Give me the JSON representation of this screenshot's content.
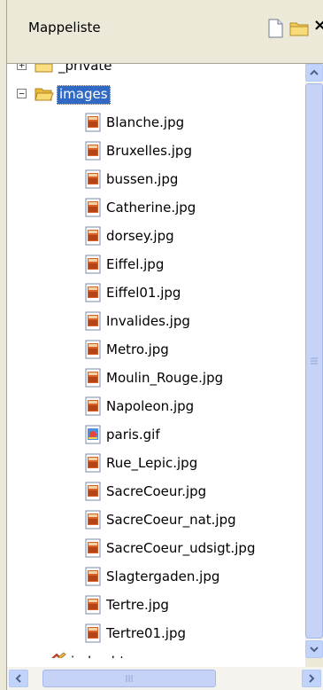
{
  "panel": {
    "title": "Mappeliste",
    "close_glyph": "×"
  },
  "tree": [
    {
      "label": "_private",
      "type": "folder",
      "expander": "+",
      "expanded": false,
      "selected": false,
      "icon": "folder-icon"
    },
    {
      "label": "images",
      "type": "folder",
      "expander": "−",
      "expanded": true,
      "selected": true,
      "icon": "folder-open-icon"
    },
    {
      "label": "Blanche.jpg",
      "type": "jpg",
      "icon": "image-file-icon"
    },
    {
      "label": "Bruxelles.jpg",
      "type": "jpg",
      "icon": "image-file-icon"
    },
    {
      "label": "bussen.jpg",
      "type": "jpg",
      "icon": "image-file-icon"
    },
    {
      "label": "Catherine.jpg",
      "type": "jpg",
      "icon": "image-file-icon"
    },
    {
      "label": "dorsey.jpg",
      "type": "jpg",
      "icon": "image-file-icon"
    },
    {
      "label": "Eiffel.jpg",
      "type": "jpg",
      "icon": "image-file-icon"
    },
    {
      "label": "Eiffel01.jpg",
      "type": "jpg",
      "icon": "image-file-icon"
    },
    {
      "label": "Invalides.jpg",
      "type": "jpg",
      "icon": "image-file-icon"
    },
    {
      "label": "Metro.jpg",
      "type": "jpg",
      "icon": "image-file-icon"
    },
    {
      "label": "Moulin_Rouge.jpg",
      "type": "jpg",
      "icon": "image-file-icon"
    },
    {
      "label": "Napoleon.jpg",
      "type": "jpg",
      "icon": "image-file-icon"
    },
    {
      "label": "paris.gif",
      "type": "gif",
      "icon": "gif-file-icon"
    },
    {
      "label": "Rue_Lepic.jpg",
      "type": "jpg",
      "icon": "image-file-icon"
    },
    {
      "label": "SacreCoeur.jpg",
      "type": "jpg",
      "icon": "image-file-icon"
    },
    {
      "label": "SacreCoeur_nat.jpg",
      "type": "jpg",
      "icon": "image-file-icon"
    },
    {
      "label": "SacreCoeur_udsigt.jpg",
      "type": "jpg",
      "icon": "image-file-icon"
    },
    {
      "label": "Slagtergaden.jpg",
      "type": "jpg",
      "icon": "image-file-icon"
    },
    {
      "label": "Tertre.jpg",
      "type": "jpg",
      "icon": "image-file-icon"
    },
    {
      "label": "Tertre01.jpg",
      "type": "jpg",
      "icon": "image-file-icon"
    },
    {
      "label": "index.htm",
      "type": "htm",
      "icon": "home-page-icon"
    }
  ],
  "colors": {
    "selection": "#316ac5",
    "chrome": "#ece9d8",
    "scrollbar": "#c6d3f7"
  }
}
